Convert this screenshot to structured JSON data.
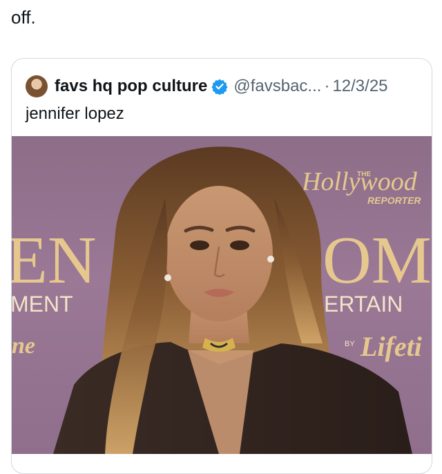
{
  "lead": {
    "text": "off."
  },
  "quoted_post": {
    "display_name": "favs hq pop culture",
    "handle": "@favsbac...",
    "separator": "·",
    "date": "12/3/25",
    "text": "jennifer lopez",
    "verified_icon": "verified-badge-icon",
    "avatar_icon": "profile-avatar"
  },
  "media": {
    "backdrop_brand": "Hollywood",
    "backdrop_brand_sub": "THE",
    "backdrop_brand_reporter": "REPORTER",
    "backdrop_left_big": "EN",
    "backdrop_left_sub": "MENT",
    "backdrop_left_script": "ne",
    "backdrop_right_big": "OMI",
    "backdrop_right_sub": "ERTAIN",
    "backdrop_right_by": "BY",
    "backdrop_right_script": "Lifeti"
  },
  "colors": {
    "text_primary": "#0f1419",
    "text_secondary": "#536471",
    "verified_blue": "#1d9bf0",
    "backdrop_purple": "#946f8f",
    "backdrop_gold": "#e6c88f"
  }
}
